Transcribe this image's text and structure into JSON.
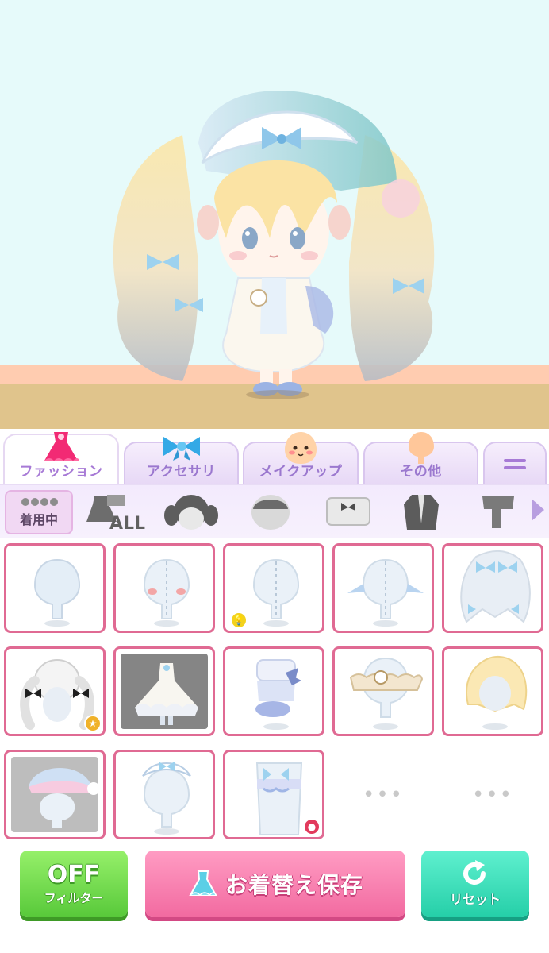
{
  "tabs": [
    {
      "label": "ファッション",
      "icon": "dress-icon",
      "active": true
    },
    {
      "label": "アクセサリ",
      "icon": "ribbon-icon",
      "active": false
    },
    {
      "label": "メイクアップ",
      "icon": "face-icon",
      "active": false
    },
    {
      "label": "その他",
      "icon": "body-icon",
      "active": false
    }
  ],
  "menu_tab": {
    "icon": "menu-icon"
  },
  "subcategories": {
    "wearing_label": "着用中",
    "all_label": "ALL",
    "items": [
      "wearing",
      "all",
      "hair",
      "face",
      "top",
      "bottom",
      "coat",
      "socks"
    ]
  },
  "grid": {
    "items": [
      {
        "name": "body-base",
        "badge": null
      },
      {
        "name": "body-blush",
        "badge": null
      },
      {
        "name": "body-stitched",
        "badge": "hint"
      },
      {
        "name": "ear-accessory",
        "badge": null
      },
      {
        "name": "long-hair-ribbons",
        "badge": null
      },
      {
        "name": "twin-tail-hair-black-ribbons",
        "badge": "star"
      },
      {
        "name": "frilly-dress",
        "badge": null
      },
      {
        "name": "blue-bow-shoes",
        "badge": null
      },
      {
        "name": "frill-collar-corset",
        "badge": null
      },
      {
        "name": "blonde-hair",
        "badge": null
      },
      {
        "name": "night-cap",
        "badge": null
      },
      {
        "name": "lace-headband",
        "badge": null
      },
      {
        "name": "butterfly-leg-garter",
        "badge": "pink"
      }
    ],
    "more_label": "•••"
  },
  "actions": {
    "filter_big": "OFF",
    "filter_small": "フィルター",
    "save_label": "お着替え保存",
    "reset_label": "リセット"
  },
  "colors": {
    "stage_bg": "#e6fafa",
    "floor": "#e0c48c",
    "cell_border": "#e06a93",
    "tab_label": "#9b78cf",
    "filter_green": "#58c93a",
    "save_pink": "#f26aa0",
    "reset_teal": "#25cfa8"
  }
}
